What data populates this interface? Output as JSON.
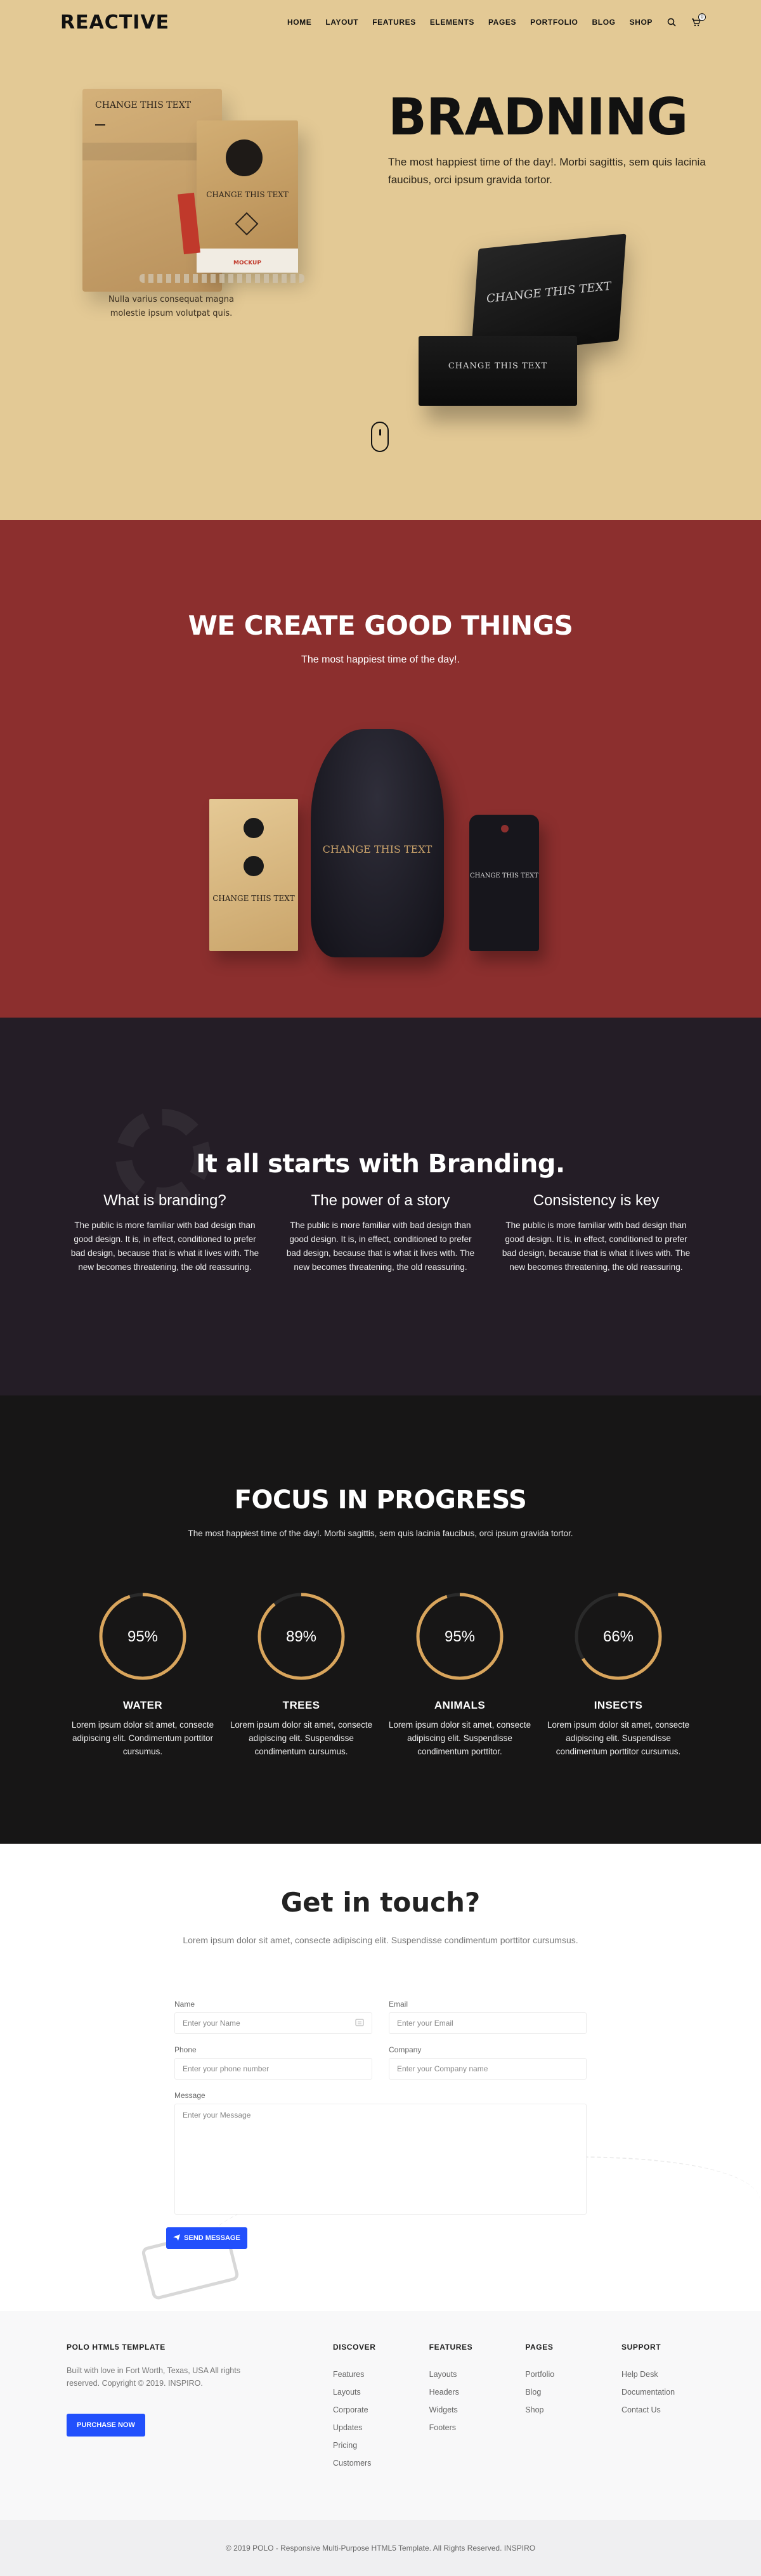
{
  "header": {
    "logo": "REACTIVE",
    "nav": [
      "HOME",
      "LAYOUT",
      "FEATURES",
      "ELEMENTS",
      "PAGES",
      "PORTFOLIO",
      "BLOG",
      "SHOP"
    ],
    "cart_count": "0"
  },
  "hero": {
    "title": "BRADNING",
    "text": "The most happiest time of the day!. Morbi sagittis, sem quis lacinia faucibus, orci ipsum gravida tortor.",
    "caption": "Nulla varius consequat magna molestie ipsum volutpat quis.",
    "mock_labels": {
      "bag": "CHANGE THIS TEXT",
      "small_bag": "CHANGE THIS TEXT",
      "box_lid": "CHANGE THIS TEXT",
      "box_base": "CHANGE THIS TEXT",
      "mockup_tag": "MOCKUP"
    }
  },
  "red": {
    "title": "WE CREATE GOOD THINGS",
    "subtitle": "The most happiest time of the day!.",
    "mock_labels": {
      "envelope": "CHANGE THIS TEXT",
      "pouch": "CHANGE THIS TEXT",
      "tag": "CHANGE THIS TEXT"
    }
  },
  "branding": {
    "title": "It all starts with Branding.",
    "columns": [
      {
        "title": "What is branding?",
        "text": "The public is more familiar with bad design than good design. It is, in effect, conditioned to prefer bad design, because that is what it lives with. The new becomes threatening, the old reassuring."
      },
      {
        "title": "The power of a story",
        "text": "The public is more familiar with bad design than good design. It is, in effect, conditioned to prefer bad design, because that is what it lives with. The new becomes threatening, the old reassuring."
      },
      {
        "title": "Consistency is key",
        "text": "The public is more familiar with bad design than good design. It is, in effect, conditioned to prefer bad design, because that is what it lives with. The new becomes threatening, the old reassuring."
      }
    ]
  },
  "focus": {
    "title": "FOCUS IN PROGRESS",
    "subtitle": "The most happiest time of the day!. Morbi sagittis, sem quis lacinia faucibus, orci ipsum gravida tortor.",
    "ring_color": "#d9a55c",
    "items": [
      {
        "value": 95,
        "label": "95%",
        "title": "WATER",
        "text": "Lorem ipsum dolor sit amet, consecte adipiscing elit. Condimentum porttitor cursumus."
      },
      {
        "value": 89,
        "label": "89%",
        "title": "TREES",
        "text": "Lorem ipsum dolor sit amet, consecte adipiscing elit. Suspendisse condimentum cursumus."
      },
      {
        "value": 95,
        "label": "95%",
        "title": "ANIMALS",
        "text": "Lorem ipsum dolor sit amet, consecte adipiscing elit. Suspendisse condimentum porttitor."
      },
      {
        "value": 66,
        "label": "66%",
        "title": "INSECTS",
        "text": "Lorem ipsum dolor sit amet, consecte adipiscing elit. Suspendisse condimentum porttitor cursumus."
      }
    ]
  },
  "contact": {
    "title": "Get in touch?",
    "lead": "Lorem ipsum dolor sit amet, consecte adipiscing elit. Suspendisse condimentum porttitor cursumsus.",
    "fields": {
      "name_label": "Name",
      "name_placeholder": "Enter your Name",
      "email_label": "Email",
      "email_placeholder": "Enter your Email",
      "phone_label": "Phone",
      "phone_placeholder": "Enter your phone number",
      "company_label": "Company",
      "company_placeholder": "Enter your Company name",
      "message_label": "Message",
      "message_placeholder": "Enter your Message"
    },
    "send_label": "SEND MESSAGE"
  },
  "footer": {
    "brand_title": "POLO HTML5 TEMPLATE",
    "brand_text": "Built with love in Fort Worth, Texas, USA All rights reserved. Copyright © 2019. INSPIRO.",
    "purchase_label": "PURCHASE NOW",
    "columns": [
      {
        "title": "DISCOVER",
        "links": [
          "Features",
          "Layouts",
          "Corporate",
          "Updates",
          "Pricing",
          "Customers"
        ]
      },
      {
        "title": "FEATURES",
        "links": [
          "Layouts",
          "Headers",
          "Widgets",
          "Footers"
        ]
      },
      {
        "title": "PAGES",
        "links": [
          "Portfolio",
          "Blog",
          "Shop"
        ]
      },
      {
        "title": "SUPPORT",
        "links": [
          "Help Desk",
          "Documentation",
          "Contact Us"
        ]
      }
    ],
    "copyright": "© 2019 POLO - Responsive Multi-Purpose HTML5 Template. All Rights Reserved. INSPIRO"
  }
}
